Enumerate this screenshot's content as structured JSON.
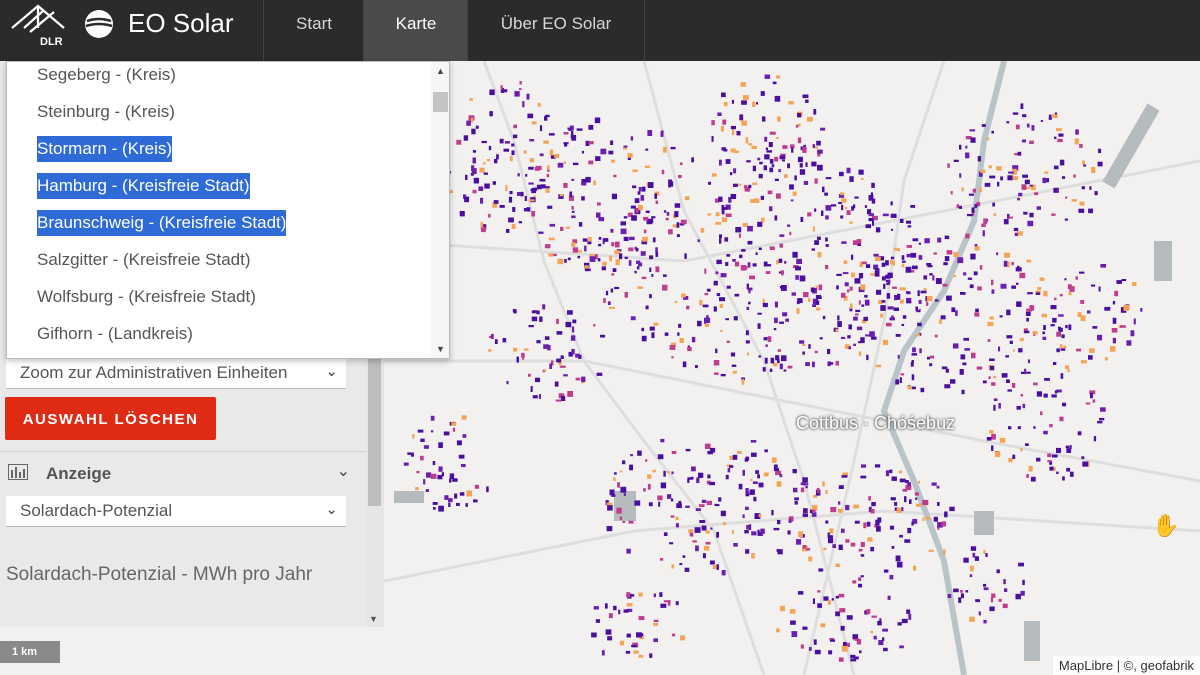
{
  "header": {
    "dlr_label": "DLR",
    "app_title": "EO Solar",
    "tabs": [
      {
        "label": "Start"
      },
      {
        "label": "Karte"
      },
      {
        "label": "Über EO Solar"
      }
    ],
    "active_tab": "Karte"
  },
  "region_list": {
    "items": [
      {
        "label": "Segeberg - (Kreis)",
        "selected": false
      },
      {
        "label": "Steinburg - (Kreis)",
        "selected": false
      },
      {
        "label": "Stormarn - (Kreis)",
        "selected": true
      },
      {
        "label": "Hamburg - (Kreisfreie Stadt)",
        "selected": true
      },
      {
        "label": "Braunschweig - (Kreisfreie Stadt)",
        "selected": true
      },
      {
        "label": "Salzgitter - (Kreisfreie Stadt)",
        "selected": false
      },
      {
        "label": "Wolfsburg - (Kreisfreie Stadt)",
        "selected": false
      },
      {
        "label": "Gifhorn - (Landkreis)",
        "selected": false
      }
    ]
  },
  "controls": {
    "zoom_select_value": "Zoom zur Administrativen Einheiten",
    "clear_button_label": "AUSWAHL LÖSCHEN",
    "display_section_label": "Anzeige",
    "display_select_value": "Solardach-Potenzial",
    "legend_title": "Solardach-Potenzial - MWh pro Jahr"
  },
  "map": {
    "city_label": "Cottbus · Chóśebuz",
    "attribution": "MapLibre | ©, geofabrik",
    "scale_label": "1 km"
  },
  "colors": {
    "selected_highlight": "#2f6bd6",
    "clear_button": "#e02b14",
    "header_bg": "#2b2b2b",
    "low_potential": "#4a0fa0",
    "mid_potential": "#c03c8c",
    "high_potential": "#f5a455"
  }
}
